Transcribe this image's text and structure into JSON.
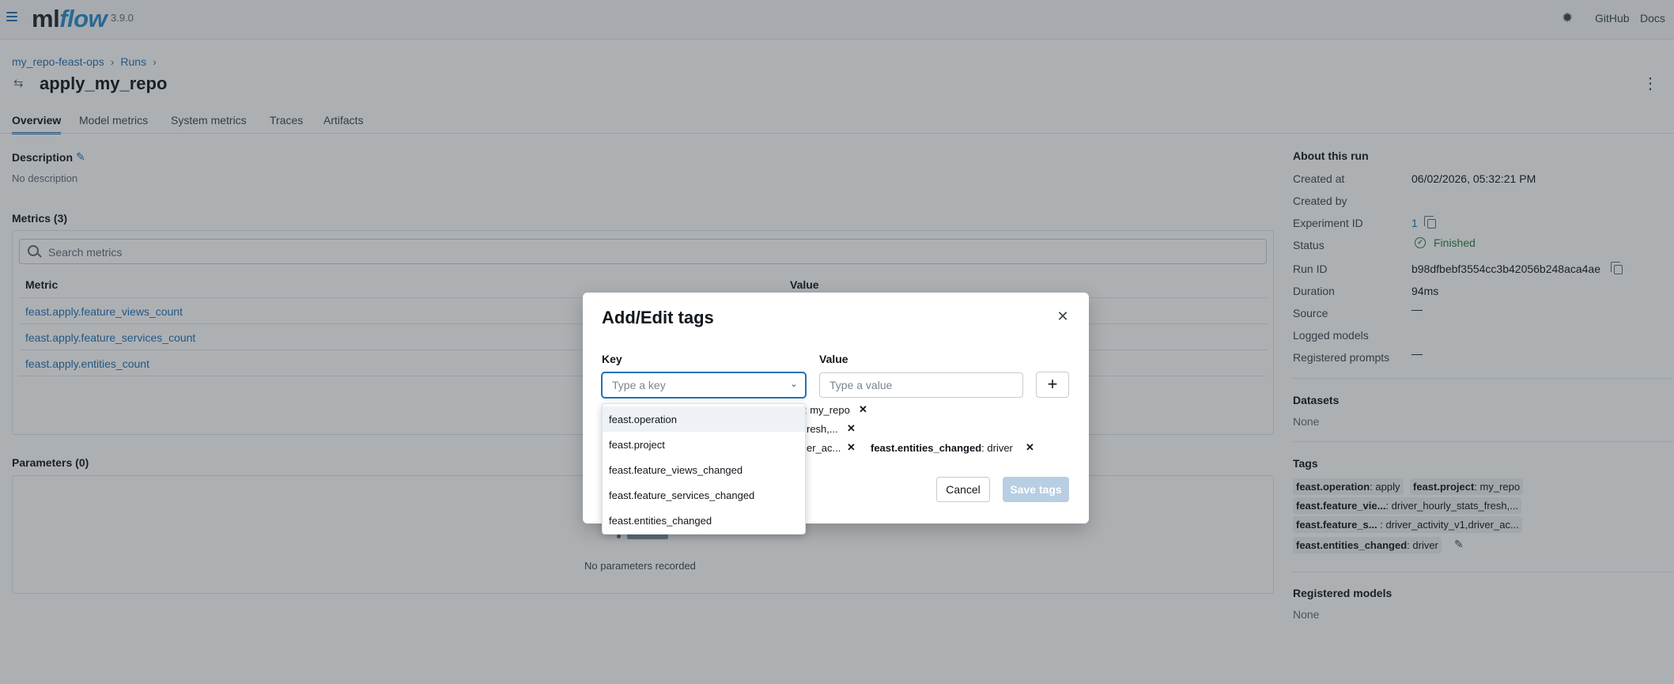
{
  "app": {
    "logo_ml": "ml",
    "logo_flow": "flow",
    "version": "3.9.0"
  },
  "header": {
    "github": "GitHub",
    "docs": "Docs"
  },
  "breadcrumb": {
    "experiment": "my_repo-feast-ops",
    "runs": "Runs",
    "separator": "›"
  },
  "run": {
    "title": "apply_my_repo"
  },
  "tabs": [
    "Overview",
    "Model metrics",
    "System metrics",
    "Traces",
    "Artifacts"
  ],
  "description": {
    "title": "Description",
    "value": "No description"
  },
  "metrics": {
    "title": "Metrics (3)",
    "search_placeholder": "Search metrics",
    "col_metric": "Metric",
    "col_value": "Value",
    "rows": [
      "feast.apply.feature_views_count",
      "feast.apply.feature_services_count",
      "feast.apply.entities_count"
    ]
  },
  "parameters": {
    "title": "Parameters (0)",
    "empty": "No parameters recorded"
  },
  "about": {
    "title": "About this run",
    "created_at_label": "Created at",
    "created_at": "06/02/2026, 05:32:21 PM",
    "created_by_label": "Created by",
    "experiment_id_label": "Experiment ID",
    "experiment_id": "1",
    "status_label": "Status",
    "status": "Finished",
    "run_id_label": "Run ID",
    "run_id": "b98dfbebf3554cc3b42056b248aca4ae",
    "duration_label": "Duration",
    "duration": "94ms",
    "source_label": "Source",
    "source": "—",
    "logged_models_label": "Logged models",
    "registered_prompts_label": "Registered prompts",
    "registered_prompts": "—"
  },
  "datasets": {
    "title": "Datasets",
    "value": "None"
  },
  "tags": {
    "title": "Tags",
    "items": [
      {
        "key": "feast.operation",
        "value": ": apply"
      },
      {
        "key": "feast.project",
        "value": ": my_repo"
      },
      {
        "key": "feast.feature_vie...",
        "value": ": driver_hourly_stats_fresh,..."
      },
      {
        "key": "feast.feature_s...",
        "value": " : driver_activity_v1,driver_ac..."
      },
      {
        "key": "feast.entities_changed",
        "value": ": driver"
      }
    ]
  },
  "registered_models": {
    "title": "Registered models",
    "value": "None"
  },
  "modal": {
    "title": "Add/Edit tags",
    "key_label": "Key",
    "value_label": "Value",
    "key_placeholder": "Type a key",
    "value_placeholder": "Type a value",
    "visible_tags": [
      {
        "text": ": my_repo"
      },
      {
        "text": "resh,..."
      },
      {
        "text": "er_ac..."
      }
    ],
    "entities_tag_key": "feast.entities_changed",
    "entities_tag_value": ": driver",
    "cancel": "Cancel",
    "save": "Save tags"
  },
  "dropdown": {
    "options": [
      "feast.operation",
      "feast.project",
      "feast.feature_views_changed",
      "feast.feature_services_changed",
      "feast.entities_changed"
    ]
  },
  "colors": {
    "accent": "#2272b4",
    "success": "#277c43",
    "overlay": "rgba(40,47,54,0.38)"
  }
}
